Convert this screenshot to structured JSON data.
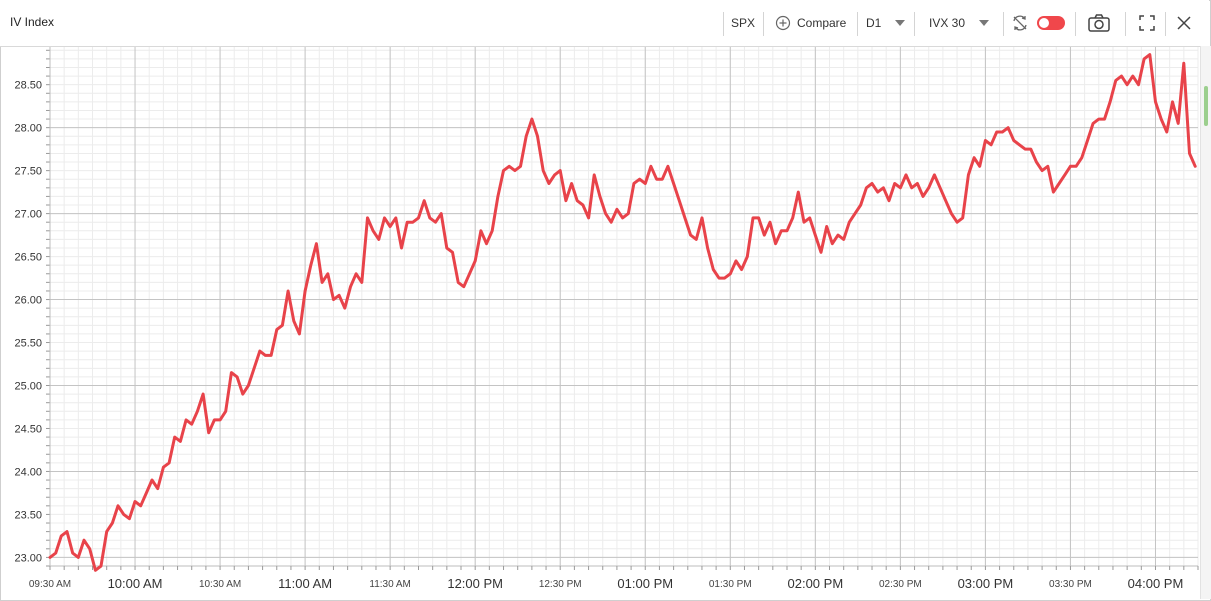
{
  "window": {
    "title": "IV Index",
    "symbol": "SPX",
    "compare_label": "Compare",
    "timeframe": "D1",
    "indicator": "IVX 30"
  },
  "colors": {
    "series": "#e8434a",
    "grid_major": "#c4c4c4",
    "grid_minor": "#ececec",
    "toggle": "#f0474b"
  },
  "chart_data": {
    "type": "line",
    "title": "IV Index",
    "ylim": [
      22.9,
      28.95
    ],
    "y_ticks": [
      "23.00",
      "23.50",
      "24.00",
      "24.50",
      "25.00",
      "25.50",
      "26.00",
      "26.50",
      "27.00",
      "27.50",
      "28.00",
      "28.50"
    ],
    "y_major": [
      "23.00",
      "24.00",
      "25.00",
      "26.00",
      "27.00",
      "28.00"
    ],
    "x_ticks": [
      {
        "t": "09:30",
        "label": "09:30 AM",
        "major": false
      },
      {
        "t": "10:00",
        "label": "10:00 AM",
        "major": true
      },
      {
        "t": "10:30",
        "label": "10:30 AM",
        "major": false
      },
      {
        "t": "11:00",
        "label": "11:00 AM",
        "major": true
      },
      {
        "t": "11:30",
        "label": "11:30 AM",
        "major": false
      },
      {
        "t": "12:00",
        "label": "12:00 PM",
        "major": true
      },
      {
        "t": "12:30",
        "label": "12:30 PM",
        "major": false
      },
      {
        "t": "13:00",
        "label": "01:00 PM",
        "major": true
      },
      {
        "t": "13:30",
        "label": "01:30 PM",
        "major": false
      },
      {
        "t": "14:00",
        "label": "02:00 PM",
        "major": true
      },
      {
        "t": "14:30",
        "label": "02:30 PM",
        "major": false
      },
      {
        "t": "15:00",
        "label": "03:00 PM",
        "major": true
      },
      {
        "t": "15:30",
        "label": "03:30 PM",
        "major": false
      },
      {
        "t": "16:00",
        "label": "04:00 PM",
        "major": true
      }
    ],
    "xlim": [
      "09:30",
      "16:15"
    ],
    "grid": true,
    "series": [
      {
        "color": "#e8434a",
        "points": [
          [
            "09:30",
            23.0
          ],
          [
            "09:32",
            23.05
          ],
          [
            "09:34",
            23.25
          ],
          [
            "09:36",
            23.3
          ],
          [
            "09:38",
            23.05
          ],
          [
            "09:40",
            23.0
          ],
          [
            "09:42",
            23.2
          ],
          [
            "09:44",
            23.1
          ],
          [
            "09:46",
            22.85
          ],
          [
            "09:48",
            22.9
          ],
          [
            "09:50",
            23.3
          ],
          [
            "09:52",
            23.4
          ],
          [
            "09:54",
            23.6
          ],
          [
            "09:56",
            23.5
          ],
          [
            "09:58",
            23.45
          ],
          [
            "10:00",
            23.65
          ],
          [
            "10:02",
            23.6
          ],
          [
            "10:04",
            23.75
          ],
          [
            "10:06",
            23.9
          ],
          [
            "10:08",
            23.8
          ],
          [
            "10:10",
            24.05
          ],
          [
            "10:12",
            24.1
          ],
          [
            "10:14",
            24.4
          ],
          [
            "10:16",
            24.35
          ],
          [
            "10:18",
            24.6
          ],
          [
            "10:20",
            24.55
          ],
          [
            "10:22",
            24.7
          ],
          [
            "10:24",
            24.9
          ],
          [
            "10:26",
            24.45
          ],
          [
            "10:28",
            24.6
          ],
          [
            "10:30",
            24.6
          ],
          [
            "10:32",
            24.7
          ],
          [
            "10:34",
            25.15
          ],
          [
            "10:36",
            25.1
          ],
          [
            "10:38",
            24.9
          ],
          [
            "10:40",
            25.0
          ],
          [
            "10:42",
            25.2
          ],
          [
            "10:44",
            25.4
          ],
          [
            "10:46",
            25.35
          ],
          [
            "10:48",
            25.35
          ],
          [
            "10:50",
            25.65
          ],
          [
            "10:52",
            25.7
          ],
          [
            "10:54",
            26.1
          ],
          [
            "10:56",
            25.75
          ],
          [
            "10:58",
            25.6
          ],
          [
            "11:00",
            26.1
          ],
          [
            "11:02",
            26.4
          ],
          [
            "11:04",
            26.65
          ],
          [
            "11:06",
            26.2
          ],
          [
            "11:08",
            26.3
          ],
          [
            "11:10",
            26.0
          ],
          [
            "11:12",
            26.05
          ],
          [
            "11:14",
            25.9
          ],
          [
            "11:16",
            26.15
          ],
          [
            "11:18",
            26.3
          ],
          [
            "11:20",
            26.2
          ],
          [
            "11:22",
            26.95
          ],
          [
            "11:24",
            26.8
          ],
          [
            "11:26",
            26.7
          ],
          [
            "11:28",
            26.95
          ],
          [
            "11:30",
            26.85
          ],
          [
            "11:32",
            26.95
          ],
          [
            "11:34",
            26.6
          ],
          [
            "11:36",
            26.9
          ],
          [
            "11:38",
            26.9
          ],
          [
            "11:40",
            26.95
          ],
          [
            "11:42",
            27.15
          ],
          [
            "11:44",
            26.95
          ],
          [
            "11:46",
            26.9
          ],
          [
            "11:48",
            27.0
          ],
          [
            "11:50",
            26.6
          ],
          [
            "11:52",
            26.55
          ],
          [
            "11:54",
            26.2
          ],
          [
            "11:56",
            26.15
          ],
          [
            "11:58",
            26.3
          ],
          [
            "12:00",
            26.45
          ],
          [
            "12:02",
            26.8
          ],
          [
            "12:04",
            26.65
          ],
          [
            "12:06",
            26.8
          ],
          [
            "12:08",
            27.2
          ],
          [
            "12:10",
            27.5
          ],
          [
            "12:12",
            27.55
          ],
          [
            "12:14",
            27.5
          ],
          [
            "12:16",
            27.55
          ],
          [
            "12:18",
            27.9
          ],
          [
            "12:20",
            28.1
          ],
          [
            "12:22",
            27.9
          ],
          [
            "12:24",
            27.5
          ],
          [
            "12:26",
            27.35
          ],
          [
            "12:28",
            27.45
          ],
          [
            "12:30",
            27.5
          ],
          [
            "12:32",
            27.15
          ],
          [
            "12:34",
            27.35
          ],
          [
            "12:36",
            27.15
          ],
          [
            "12:38",
            27.1
          ],
          [
            "12:40",
            26.95
          ],
          [
            "12:42",
            27.45
          ],
          [
            "12:44",
            27.2
          ],
          [
            "12:46",
            27.0
          ],
          [
            "12:48",
            26.9
          ],
          [
            "12:50",
            27.05
          ],
          [
            "12:52",
            26.95
          ],
          [
            "12:54",
            27.0
          ],
          [
            "12:56",
            27.35
          ],
          [
            "12:58",
            27.4
          ],
          [
            "13:00",
            27.35
          ],
          [
            "13:02",
            27.55
          ],
          [
            "13:04",
            27.4
          ],
          [
            "13:06",
            27.4
          ],
          [
            "13:08",
            27.55
          ],
          [
            "13:10",
            27.35
          ],
          [
            "13:12",
            27.15
          ],
          [
            "13:14",
            26.95
          ],
          [
            "13:16",
            26.75
          ],
          [
            "13:18",
            26.7
          ],
          [
            "13:20",
            26.95
          ],
          [
            "13:22",
            26.6
          ],
          [
            "13:24",
            26.35
          ],
          [
            "13:26",
            26.25
          ],
          [
            "13:28",
            26.25
          ],
          [
            "13:30",
            26.3
          ],
          [
            "13:32",
            26.45
          ],
          [
            "13:34",
            26.35
          ],
          [
            "13:36",
            26.5
          ],
          [
            "13:38",
            26.95
          ],
          [
            "13:40",
            26.95
          ],
          [
            "13:42",
            26.75
          ],
          [
            "13:44",
            26.9
          ],
          [
            "13:46",
            26.65
          ],
          [
            "13:48",
            26.8
          ],
          [
            "13:50",
            26.8
          ],
          [
            "13:52",
            26.95
          ],
          [
            "13:54",
            27.25
          ],
          [
            "13:56",
            26.9
          ],
          [
            "13:58",
            26.95
          ],
          [
            "14:00",
            26.75
          ],
          [
            "14:02",
            26.55
          ],
          [
            "14:04",
            26.85
          ],
          [
            "14:06",
            26.65
          ],
          [
            "14:08",
            26.75
          ],
          [
            "14:10",
            26.7
          ],
          [
            "14:12",
            26.9
          ],
          [
            "14:14",
            27.0
          ],
          [
            "14:16",
            27.1
          ],
          [
            "14:18",
            27.3
          ],
          [
            "14:20",
            27.35
          ],
          [
            "14:22",
            27.25
          ],
          [
            "14:24",
            27.3
          ],
          [
            "14:26",
            27.15
          ],
          [
            "14:28",
            27.35
          ],
          [
            "14:30",
            27.3
          ],
          [
            "14:32",
            27.45
          ],
          [
            "14:34",
            27.3
          ],
          [
            "14:36",
            27.35
          ],
          [
            "14:38",
            27.2
          ],
          [
            "14:40",
            27.3
          ],
          [
            "14:42",
            27.45
          ],
          [
            "14:44",
            27.3
          ],
          [
            "14:46",
            27.15
          ],
          [
            "14:48",
            27.0
          ],
          [
            "14:50",
            26.9
          ],
          [
            "14:52",
            26.95
          ],
          [
            "14:54",
            27.45
          ],
          [
            "14:56",
            27.65
          ],
          [
            "14:58",
            27.55
          ],
          [
            "15:00",
            27.85
          ],
          [
            "15:02",
            27.8
          ],
          [
            "15:04",
            27.95
          ],
          [
            "15:06",
            27.95
          ],
          [
            "15:08",
            28.0
          ],
          [
            "15:10",
            27.85
          ],
          [
            "15:12",
            27.8
          ],
          [
            "15:14",
            27.75
          ],
          [
            "15:16",
            27.75
          ],
          [
            "15:18",
            27.6
          ],
          [
            "15:20",
            27.5
          ],
          [
            "15:22",
            27.55
          ],
          [
            "15:24",
            27.25
          ],
          [
            "15:26",
            27.35
          ],
          [
            "15:28",
            27.45
          ],
          [
            "15:30",
            27.55
          ],
          [
            "15:32",
            27.55
          ],
          [
            "15:34",
            27.65
          ],
          [
            "15:36",
            27.85
          ],
          [
            "15:38",
            28.05
          ],
          [
            "15:40",
            28.1
          ],
          [
            "15:42",
            28.1
          ],
          [
            "15:44",
            28.3
          ],
          [
            "15:46",
            28.55
          ],
          [
            "15:48",
            28.6
          ],
          [
            "15:50",
            28.5
          ],
          [
            "15:52",
            28.6
          ],
          [
            "15:54",
            28.5
          ],
          [
            "15:56",
            28.8
          ],
          [
            "15:58",
            28.85
          ],
          [
            "16:00",
            28.3
          ],
          [
            "16:02",
            28.1
          ],
          [
            "16:04",
            27.95
          ],
          [
            "16:06",
            28.3
          ],
          [
            "16:08",
            28.05
          ],
          [
            "16:10",
            28.75
          ],
          [
            "16:12",
            27.7
          ],
          [
            "16:14",
            27.55
          ]
        ]
      }
    ]
  }
}
